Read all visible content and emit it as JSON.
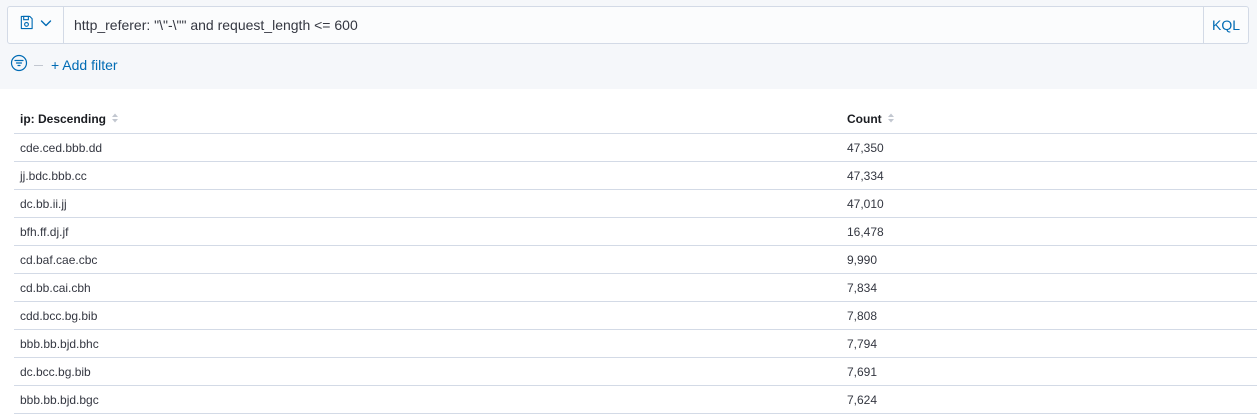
{
  "query_bar": {
    "query": "http_referer: \"\\\"-\\\"\" and request_length <= 600",
    "language_label": "KQL",
    "saved_query_icon": "save-icon",
    "dropdown_icon": "chevron-down-icon"
  },
  "filters": {
    "menu_icon": "filter-icon",
    "add_filter_label": "+ Add filter"
  },
  "table": {
    "columns": [
      "ip: Descending",
      "Count"
    ],
    "rows": [
      {
        "ip": "cde.ced.bbb.dd",
        "count": "47,350"
      },
      {
        "ip": "jj.bdc.bbb.cc",
        "count": "47,334"
      },
      {
        "ip": "dc.bb.ii.jj",
        "count": "47,010"
      },
      {
        "ip": "bfh.ff.dj.jf",
        "count": "16,478"
      },
      {
        "ip": "cd.baf.cae.cbc",
        "count": "9,990"
      },
      {
        "ip": "cd.bb.cai.cbh",
        "count": "7,834"
      },
      {
        "ip": "cdd.bcc.bg.bib",
        "count": "7,808"
      },
      {
        "ip": "bbb.bb.bjd.bhc",
        "count": "7,794"
      },
      {
        "ip": "dc.bcc.bg.bib",
        "count": "7,691"
      },
      {
        "ip": "bbb.bb.bjd.bgc",
        "count": "7,624"
      }
    ]
  },
  "colors": {
    "link": "#006bb4",
    "border": "#d3dae6",
    "query_background": "#f5f7fa"
  }
}
